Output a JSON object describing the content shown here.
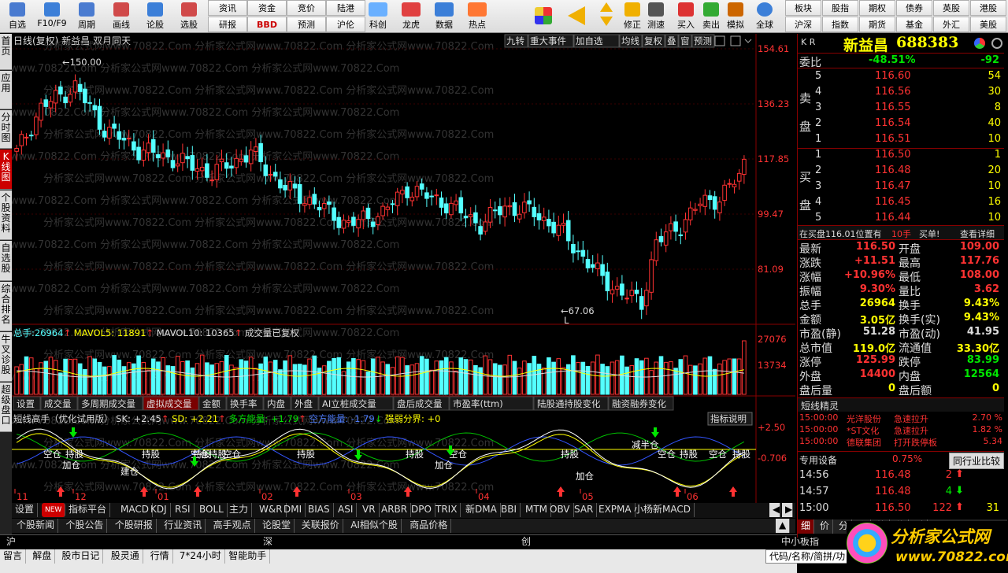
{
  "toolbar": {
    "main_buttons": [
      {
        "label": "自选",
        "icon": "grid-icon"
      },
      {
        "label": "F10/F9",
        "icon": "info-icon"
      },
      {
        "label": "周期",
        "icon": "clock-icon"
      },
      {
        "label": "画线",
        "icon": "pencil-icon"
      },
      {
        "label": "论股",
        "icon": "chat-icon"
      },
      {
        "label": "选股",
        "icon": "radar-icon"
      }
    ],
    "grid_top": [
      "资讯",
      "资金",
      "竞价",
      "陆港"
    ],
    "grid_bottom": [
      "研报",
      "BBD",
      "预测",
      "沪伦"
    ],
    "app_buttons": [
      {
        "label": "科创",
        "icon": "science-icon"
      },
      {
        "label": "龙虎",
        "icon": "dragon-icon"
      },
      {
        "label": "数据",
        "icon": "pe-icon"
      },
      {
        "label": "热点",
        "icon": "hot-icon"
      }
    ],
    "nav_buttons": [
      {
        "label": "修正",
        "icon": "refresh-icon"
      },
      {
        "label": "测速",
        "icon": "speedometer-icon"
      },
      {
        "label": "买入",
        "icon": "buy-icon"
      },
      {
        "label": "卖出",
        "icon": "sell-icon"
      },
      {
        "label": "模拟",
        "icon": "gavel-icon"
      },
      {
        "label": "全球",
        "icon": "globe-icon"
      }
    ],
    "right_top": [
      "板块",
      "股指",
      "期权",
      "债券",
      "英股",
      "港股"
    ],
    "right_bottom": [
      "指数",
      "期货",
      "基金",
      "外汇",
      "美股"
    ],
    "right_bottom_first": "沪深"
  },
  "left_tabs": [
    "首页",
    "应用",
    "分时图",
    "K线图",
    "个股资料",
    "自选股",
    "综合排名",
    "牛叉诊股",
    "超级盘口"
  ],
  "chart": {
    "title": "日线(复权) 新益昌 双月同天",
    "watermark": "分析家公式网www.70822.Com",
    "top_buttons": [
      "九转",
      "重大事件",
      "加自选",
      "均线",
      "复权",
      "叠",
      "窗",
      "预测"
    ],
    "price_axis": [
      "154.61",
      "136.23",
      "117.85",
      "99.47",
      "81.09"
    ],
    "high_label": "150.00",
    "low_label": "67.06",
    "low_marker": "L",
    "volume_legend": {
      "total_label": "总手:",
      "total": "26964",
      "mavol5_label": "MAVOL5:",
      "mavol5": "11891",
      "mavol10_label": "MAVOL10:",
      "mavol10": "10365",
      "note": "成交量已复权"
    },
    "volume_axis": [
      "27076",
      "13734"
    ],
    "ind_tabs": [
      "设置",
      "成交量",
      "多周期成交量",
      "虚拟成交量",
      "金额",
      "换手率",
      "内盘",
      "外盘",
      "AI立桩成交量",
      "盘后成交量",
      "市盈率(ttm)",
      "陆股通持股变化",
      "融资融券变化"
    ],
    "indicator_legend": {
      "name": "短线高手（优化试用版）",
      "sk": "SK: +2.45",
      "sd": "SD: +2.21",
      "dk": "多方能量: +1.79",
      "kk": "空方能量: -1.79",
      "qr": "强弱分界: +0",
      "help": "指标说明"
    },
    "indicator_axis": [
      "+2.50",
      "-0.706"
    ],
    "signal_labels": [
      "空仓",
      "持股",
      "加仓",
      "持股",
      "建仓",
      "持股",
      "空仓",
      "持股",
      "空仓",
      "持股",
      "持股",
      "加仓",
      "空仓",
      "持股",
      "加仓",
      "减半仓",
      "空仓",
      "持股",
      "空仓",
      "持股"
    ],
    "date_axis": [
      "11",
      "12",
      "01",
      "02",
      "03",
      "04",
      "05",
      "06"
    ],
    "bottom_tabs": [
      "设置",
      "NEW",
      "指标平台",
      "MACD",
      "KDJ",
      "RSI",
      "BOLL",
      "主力",
      "W&R",
      "DMI",
      "BIAS",
      "ASI",
      "VR",
      "ARBR",
      "DPO",
      "TRIX",
      "新DMA",
      "BBI",
      "MTM",
      "OBV",
      "SAR",
      "EXPMA",
      "小杨新MACD"
    ]
  },
  "news_tabs": [
    "个股新闻",
    "个股公告",
    "个股研报",
    "行业资讯",
    "高手观点",
    "论股堂",
    "关联报价",
    "AI相似个股",
    "商品价格"
  ],
  "quote": {
    "code_label": "K R",
    "name": "新益昌",
    "code": "688383",
    "weibi_label": "委比",
    "weibi": "-48.51%",
    "weicha": "-92",
    "sell_label": "卖盘",
    "buy_label": "买盘",
    "sell": [
      {
        "lvl": "5",
        "price": "116.60",
        "vol": "54"
      },
      {
        "lvl": "4",
        "price": "116.56",
        "vol": "30"
      },
      {
        "lvl": "3",
        "price": "116.55",
        "vol": "8"
      },
      {
        "lvl": "2",
        "price": "116.54",
        "vol": "40"
      },
      {
        "lvl": "1",
        "price": "116.51",
        "vol": "10"
      }
    ],
    "buy": [
      {
        "lvl": "1",
        "price": "116.50",
        "vol": "1"
      },
      {
        "lvl": "2",
        "price": "116.48",
        "vol": "20"
      },
      {
        "lvl": "3",
        "price": "116.47",
        "vol": "10"
      },
      {
        "lvl": "4",
        "price": "116.45",
        "vol": "16"
      },
      {
        "lvl": "5",
        "price": "116.44",
        "vol": "10"
      }
    ],
    "order_line": {
      "text": "在买盘116.01位置有",
      "qty": "10手",
      "action": "买单!",
      "detail": "查看详细"
    },
    "stats": [
      {
        "l1": "最新",
        "v1": "116.50",
        "c1": "red",
        "l2": "开盘",
        "v2": "109.00",
        "c2": "red"
      },
      {
        "l1": "涨跌",
        "v1": "+11.51",
        "c1": "red",
        "l2": "最高",
        "v2": "117.76",
        "c2": "red"
      },
      {
        "l1": "涨幅",
        "v1": "+10.96%",
        "c1": "red",
        "l2": "最低",
        "v2": "108.00",
        "c2": "red"
      },
      {
        "l1": "振幅",
        "v1": "9.30%",
        "c1": "red",
        "l2": "量比",
        "v2": "3.62",
        "c2": "red"
      },
      {
        "l1": "总手",
        "v1": "26964",
        "c1": "yellow",
        "l2": "换手",
        "v2": "9.43%",
        "c2": "yellow"
      },
      {
        "l1": "金额",
        "v1": "3.05亿",
        "c1": "yellow",
        "l2": "换手(实)",
        "v2": "9.43%",
        "c2": "yellow"
      },
      {
        "l1": "市盈(静)",
        "v1": "51.28",
        "c1": "white",
        "l2": "市盈(动)",
        "v2": "41.95",
        "c2": "white"
      },
      {
        "l1": "总市值",
        "v1": "119.0亿",
        "c1": "yellow",
        "l2": "流通值",
        "v2": "33.30亿",
        "c2": "yellow"
      },
      {
        "l1": "涨停",
        "v1": "125.99",
        "c1": "red",
        "l2": "跌停",
        "v2": "83.99",
        "c2": "green"
      },
      {
        "l1": "外盘",
        "v1": "14400",
        "c1": "red",
        "l2": "内盘",
        "v2": "12564",
        "c2": "green"
      },
      {
        "l1": "盘后量",
        "v1": "0",
        "c1": "yellow",
        "l2": "盘后额",
        "v2": "0",
        "c2": "yellow"
      }
    ],
    "elves_title": "短线精灵",
    "elves": [
      {
        "time": "15:00:00",
        "name": "光洋股份",
        "event": "急速拉升",
        "val": "2.70 %"
      },
      {
        "time": "15:00:00",
        "name": "*ST文化",
        "event": "急速拉升",
        "val": "1.82 %"
      },
      {
        "time": "15:00:00",
        "name": "德联集团",
        "event": "打开跌停板",
        "val": "5.34"
      }
    ],
    "special": {
      "label": "专用设备",
      "pct": "0.75%",
      "button": "同行业比较"
    },
    "ticks": [
      {
        "time": "14:56",
        "price": "116.48",
        "vol": "2",
        "dir": "up"
      },
      {
        "time": "14:57",
        "price": "116.48",
        "vol": "4",
        "dir": "down"
      },
      {
        "time": "15:00",
        "price": "116.50",
        "vol": "122",
        "dir": "up",
        "num": "31"
      }
    ],
    "bottom_tabs": [
      "细",
      "价",
      "分",
      "资",
      "势",
      "值",
      "财"
    ]
  },
  "index_bar": [
    {
      "label": "沪",
      "value": ""
    },
    {
      "label": "深",
      "value": ""
    },
    {
      "label": "创",
      "value": ""
    },
    {
      "label": "中小板指",
      "value": ""
    }
  ],
  "status_bar": [
    "留言",
    "解盘",
    "股市日记",
    "股灵通",
    "行情",
    "7*24小时",
    "智能助手"
  ],
  "search_hint": "代码/名称/简拼/功",
  "logo": {
    "brand": "分析家公式网",
    "url": "www.70822.com"
  },
  "colors": {
    "up": "#ff3232",
    "down": "#54ffff",
    "accent": "#ff3232"
  }
}
